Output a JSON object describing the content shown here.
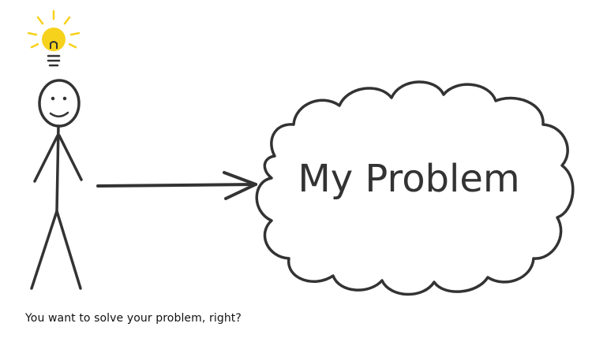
{
  "cloud": {
    "label": "My Problem"
  },
  "caption": {
    "text": "You want to solve your problem, right?"
  },
  "colors": {
    "ink": "#333333",
    "bulb": "#f7d21c",
    "background": "#ffffff"
  },
  "icons": [
    "light-bulb-icon",
    "stick-figure-icon",
    "arrow-icon",
    "cloud-icon"
  ]
}
